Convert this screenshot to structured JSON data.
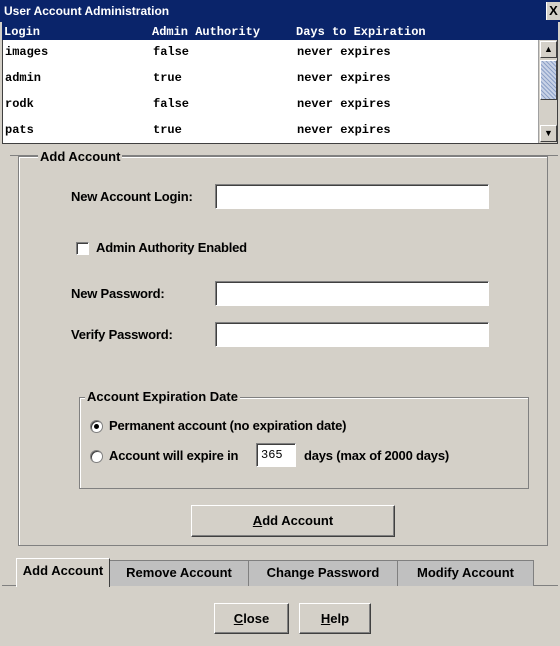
{
  "window": {
    "title": "User Account Administration",
    "close_glyph": "X"
  },
  "table": {
    "columns": [
      "Login",
      "Admin Authority",
      "Days to Expiration"
    ],
    "rows": [
      {
        "login": "images",
        "admin": "false",
        "days": "never expires"
      },
      {
        "login": "admin",
        "admin": "true",
        "days": "never expires"
      },
      {
        "login": "rodk",
        "admin": "false",
        "days": "never expires"
      },
      {
        "login": "pats",
        "admin": "true",
        "days": "never expires"
      }
    ]
  },
  "form": {
    "group_title": "Add Account",
    "new_login_label": "New Account Login:",
    "new_login_value": "",
    "admin_checkbox_label": "Admin Authority Enabled",
    "admin_checked": false,
    "new_password_label": "New Password:",
    "new_password_value": "",
    "verify_password_label": "Verify Password:",
    "verify_password_value": "",
    "expiration": {
      "title": "Account Expiration Date",
      "permanent_label": "Permanent account (no expiration date)",
      "permanent_selected": true,
      "expire_prefix": "Account will expire in",
      "expire_days_value": "365",
      "expire_suffix": "days (max of 2000 days)"
    },
    "add_button_mnemonic": "A",
    "add_button_rest": "dd Account"
  },
  "tabs": [
    {
      "label": "Add Account",
      "active": true
    },
    {
      "label": "Remove Account",
      "active": false
    },
    {
      "label": "Change Password",
      "active": false
    },
    {
      "label": "Modify Account",
      "active": false
    }
  ],
  "footer": {
    "close_mnemonic": "C",
    "close_rest": "lose",
    "help_mnemonic": "H",
    "help_rest": "elp"
  },
  "icons": {
    "scroll_up": "scroll-up-arrow-icon",
    "scroll_down": "scroll-down-arrow-icon"
  },
  "colors": {
    "titlebar": "#0a246a",
    "face": "#d4d0c8",
    "table_bg": "#ffffff"
  }
}
